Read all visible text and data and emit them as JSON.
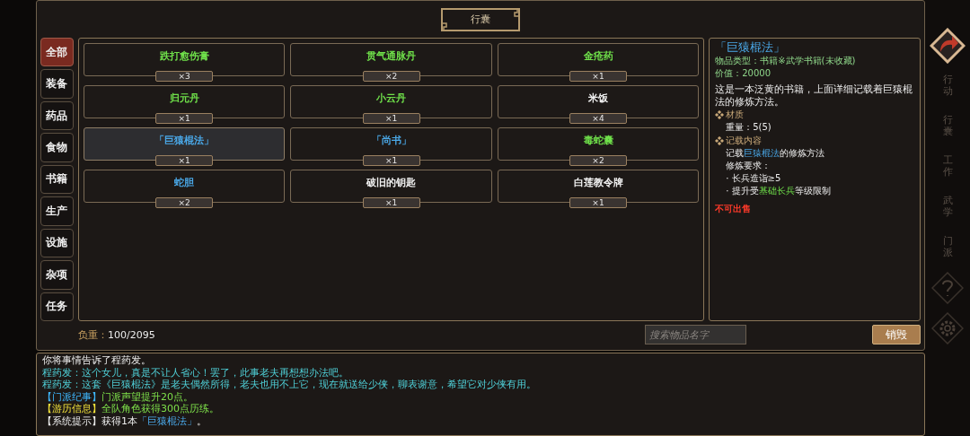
{
  "title": "行囊",
  "tabs": [
    {
      "label": "全部",
      "selected": true
    },
    {
      "label": "装备",
      "selected": false
    },
    {
      "label": "药品",
      "selected": false
    },
    {
      "label": "食物",
      "selected": false
    },
    {
      "label": "书籍",
      "selected": false
    },
    {
      "label": "生产",
      "selected": false
    },
    {
      "label": "设施",
      "selected": false
    },
    {
      "label": "杂项",
      "selected": false
    },
    {
      "label": "任务",
      "selected": false
    }
  ],
  "items": [
    {
      "name": "跌打愈伤膏",
      "count": "×3",
      "color": "#6fe04a",
      "selected": false
    },
    {
      "name": "贯气通脉丹",
      "count": "×2",
      "color": "#6fe04a",
      "selected": false
    },
    {
      "name": "金疮药",
      "count": "×1",
      "color": "#6fe04a",
      "selected": false
    },
    {
      "name": "归元丹",
      "count": "×1",
      "color": "#6fe04a",
      "selected": false
    },
    {
      "name": "小云丹",
      "count": "×1",
      "color": "#6fe04a",
      "selected": false
    },
    {
      "name": "米饭",
      "count": "×4",
      "color": "#f0f0f0",
      "selected": false
    },
    {
      "name": "「巨猿棍法」",
      "count": "×1",
      "color": "#4aa8e8",
      "selected": true
    },
    {
      "name": "「尚书」",
      "count": "×1",
      "color": "#4aa8e8",
      "selected": false
    },
    {
      "name": "毒蛇囊",
      "count": "×2",
      "color": "#6fe04a",
      "selected": false
    },
    {
      "name": "蛇胆",
      "count": "×2",
      "color": "#4aa8e8",
      "selected": false
    },
    {
      "name": "破旧的钥匙",
      "count": "×1",
      "color": "#f0f0f0",
      "selected": false
    },
    {
      "name": "白莲教令牌",
      "count": "×1",
      "color": "#f0f0f0",
      "selected": false
    }
  ],
  "weight": {
    "label": "负重：",
    "value": "100/2095"
  },
  "search": {
    "placeholder": "搜索物品名字"
  },
  "destroy_button": "销毁",
  "detail": {
    "title": "「巨猿棍法」",
    "type": "物品类型：书籍※武学书籍(未收藏)",
    "value": "价值：20000",
    "description": "这是一本泛黄的书籍，上面详细记载着巨猿棍法的修炼方法。",
    "sections": [
      {
        "heading": "材质",
        "lines": [
          [
            {
              "text": "重量：5(5)",
              "kind": "plain"
            }
          ]
        ]
      },
      {
        "heading": "记载内容",
        "lines": [
          [
            {
              "text": "记载",
              "kind": "plain"
            },
            {
              "text": "巨猿棍法",
              "kind": "skill"
            },
            {
              "text": "的修炼方法",
              "kind": "plain"
            }
          ],
          [
            {
              "text": "修炼要求：",
              "kind": "plain"
            }
          ],
          [
            {
              "text": "· 长兵造诣≥5",
              "kind": "plain"
            }
          ],
          [
            {
              "text": "· 提升受",
              "kind": "plain"
            },
            {
              "text": "基础长兵",
              "kind": "green"
            },
            {
              "text": "等级限制",
              "kind": "plain"
            }
          ]
        ]
      }
    ],
    "warning": "不可出售"
  },
  "log": [
    [
      {
        "text": "你将事情告诉了程药发。",
        "kind": "plain"
      }
    ],
    [
      {
        "text": "程药发：这个女儿，真是不让人省心！罢了，此事老夫再想想办法吧。",
        "kind": "speech"
      }
    ],
    [
      {
        "text": "程药发：这套《巨猿棍法》是老夫偶然所得，老夫也用不上它，现在就送给少侠，聊表谢意，希望它对少侠有用。",
        "kind": "speech"
      }
    ],
    [
      {
        "text": "【门派纪事】",
        "kind": "sect"
      },
      {
        "text": "门派声望提升20点。",
        "kind": "gain"
      }
    ],
    [
      {
        "text": "【游历信息】",
        "kind": "travel"
      },
      {
        "text": "全队角色获得300点历练。",
        "kind": "gain"
      }
    ],
    [
      {
        "text": "【系统提示】获得1本",
        "kind": "plain"
      },
      {
        "text": "「巨猿棍法」",
        "kind": "item"
      },
      {
        "text": "。",
        "kind": "plain"
      }
    ]
  ],
  "rail": [
    {
      "kind": "arrow"
    },
    {
      "kind": "label",
      "text": "行动"
    },
    {
      "kind": "label",
      "text": "行囊"
    },
    {
      "kind": "label",
      "text": "工作"
    },
    {
      "kind": "label",
      "text": "武学"
    },
    {
      "kind": "label",
      "text": "门派"
    },
    {
      "kind": "help"
    },
    {
      "kind": "gear"
    }
  ]
}
